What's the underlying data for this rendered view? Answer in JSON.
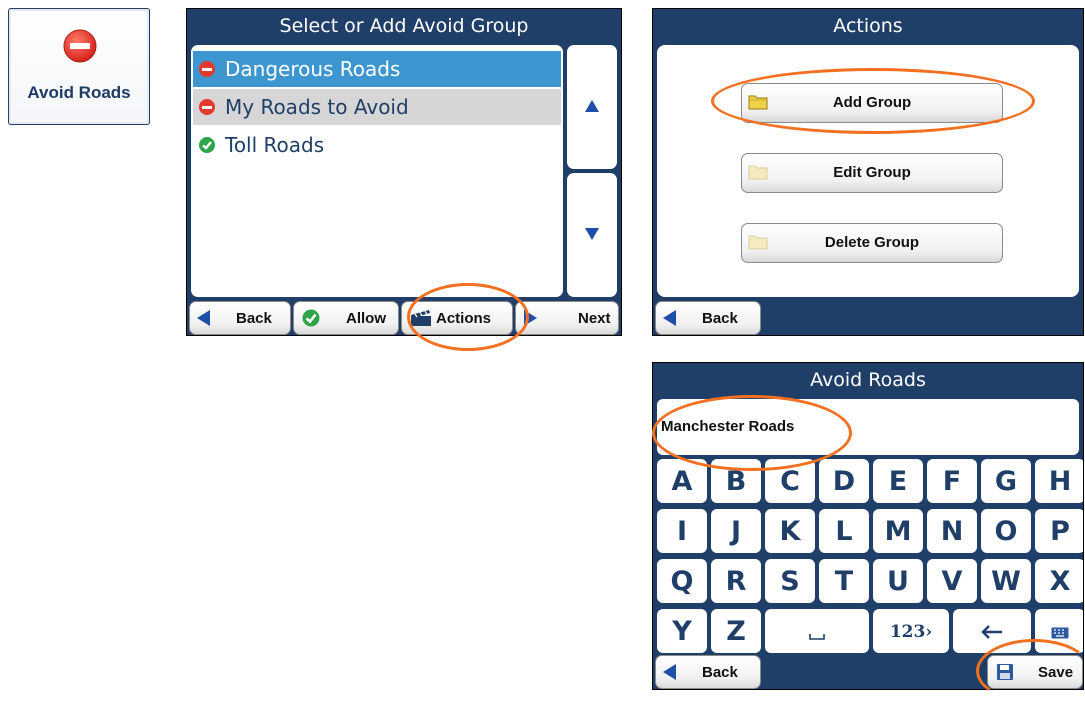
{
  "tile": {
    "label": "Avoid Roads"
  },
  "select_panel": {
    "title": "Select or Add Avoid Group",
    "items": [
      {
        "label": "Dangerous Roads",
        "state": "avoid",
        "selected": true
      },
      {
        "label": "My Roads to Avoid",
        "state": "avoid",
        "selected": false
      },
      {
        "label": "Toll Roads",
        "state": "allow",
        "selected": false
      }
    ],
    "buttons": {
      "back": "Back",
      "allow": "Allow",
      "actions": "Actions",
      "next": "Next"
    }
  },
  "actions_panel": {
    "title": "Actions",
    "buttons": [
      "Add Group",
      "Edit Group",
      "Delete Group"
    ],
    "back": "Back"
  },
  "keyboard_panel": {
    "title": "Avoid Roads",
    "input_value": "Manchester Roads",
    "rows": [
      [
        "A",
        "B",
        "C",
        "D",
        "E",
        "F",
        "G",
        "H"
      ],
      [
        "I",
        "J",
        "K",
        "L",
        "M",
        "N",
        "O",
        "P"
      ],
      [
        "Q",
        "R",
        "S",
        "T",
        "U",
        "V",
        "W",
        "X"
      ],
      [
        "Y",
        "Z"
      ]
    ],
    "numbers_key": "123›",
    "back": "Back",
    "save": "Save"
  },
  "colors": {
    "panel": "#1f3f69",
    "highlight": "#f2701f",
    "selected_row": "#3d96cf"
  }
}
